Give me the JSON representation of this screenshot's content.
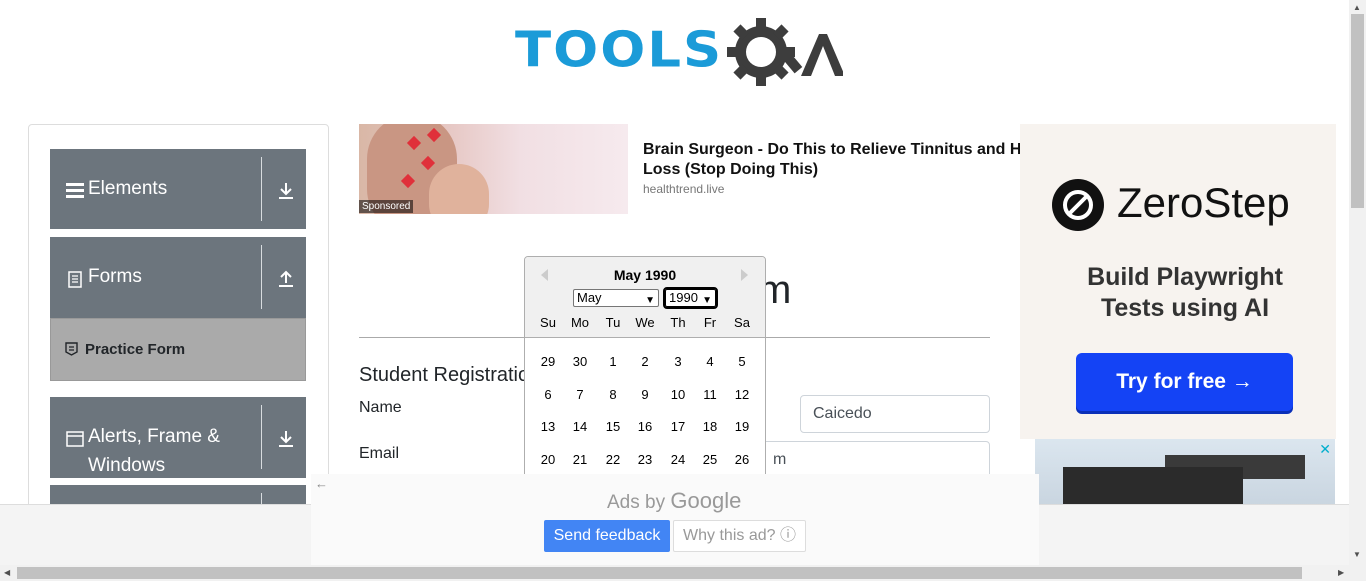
{
  "header": {
    "logo_text": "TOOLS",
    "logo_suffix": "QA"
  },
  "sidebar": {
    "groups": [
      {
        "label": "Elements",
        "icon": "hamburger-icon",
        "arrow": "download-arrow-icon"
      },
      {
        "label": "Forms",
        "icon": "document-icon",
        "arrow": "upload-arrow-icon"
      },
      {
        "label": "Alerts, Frame &",
        "label2": "Windows",
        "icon": "window-icon",
        "arrow": "download-arrow-icon"
      }
    ],
    "active_item": "Practice Form"
  },
  "top_ad": {
    "sponsored": "Sponsored",
    "headline_line1": "Brain Surgeon - Do This to Relieve Tinnitus and H",
    "headline_line2": "Loss (Stop Doing This)",
    "domain": "healthtrend.live"
  },
  "form": {
    "heading_fragment": "m",
    "section_title": "Student Registratio",
    "name_label": "Name",
    "last_name_value": "Caicedo",
    "email_label": "Email",
    "email_fragment": "m"
  },
  "datepicker": {
    "title": "May 1990",
    "month_value": "May",
    "year_value": "1990",
    "weekdays": [
      "Su",
      "Mo",
      "Tu",
      "We",
      "Th",
      "Fr",
      "Sa"
    ],
    "weeks": [
      [
        "29",
        "30",
        "1",
        "2",
        "3",
        "4",
        "5"
      ],
      [
        "6",
        "7",
        "8",
        "9",
        "10",
        "11",
        "12"
      ],
      [
        "13",
        "14",
        "15",
        "16",
        "17",
        "18",
        "19"
      ],
      [
        "20",
        "21",
        "22",
        "23",
        "24",
        "25",
        "26"
      ]
    ]
  },
  "right_ad": {
    "brand": "ZeroStep",
    "tagline1": "Build Playwright",
    "tagline2": "Tests using AI",
    "cta": "Try for free →",
    "close": "✕"
  },
  "bottom_ad": {
    "back": "←",
    "ads_by": "Ads by",
    "google": "Google",
    "send_feedback": "Send feedback",
    "why_this_ad": "Why this ad? ⓘ"
  },
  "colors": {
    "brand_blue": "#1b9bd8",
    "sidebar_gray": "#6c757d",
    "cta_blue": "#1443f5",
    "feedback_blue": "#4285f4"
  }
}
